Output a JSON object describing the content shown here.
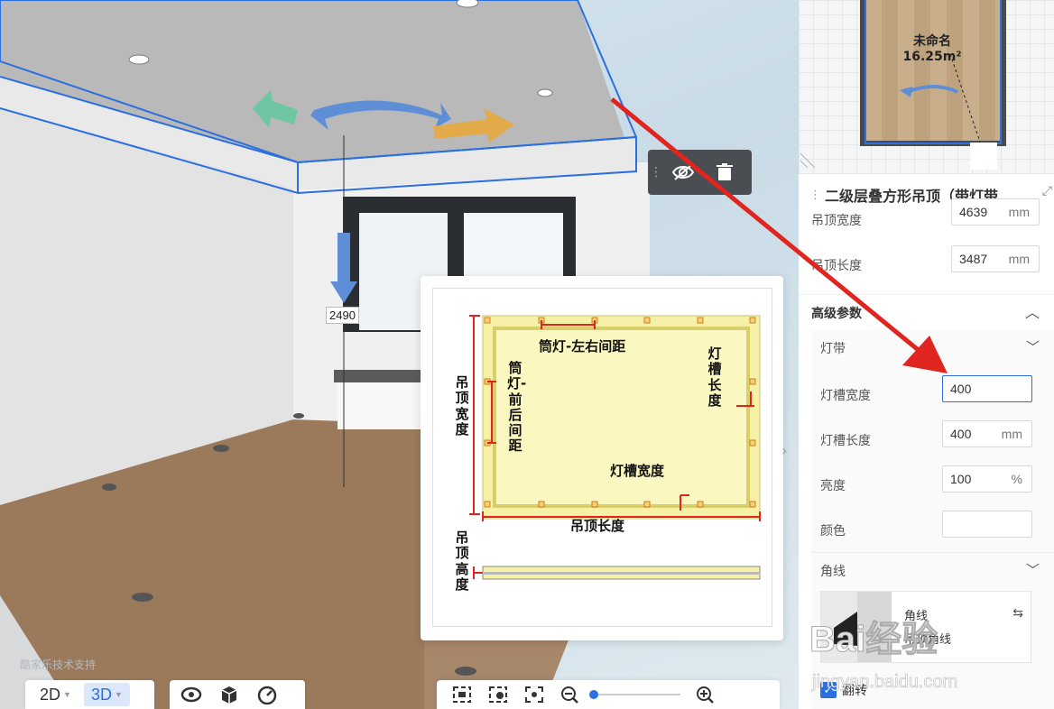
{
  "viewport": {
    "height_label": "2490",
    "watermark": "酷家乐技术支持",
    "view_modes": [
      {
        "label": "2D",
        "active": false
      },
      {
        "label": "3D",
        "active": true
      }
    ],
    "zoom_fraction": 0.0
  },
  "diagram": {
    "label_spot_lr": "筒灯-左右间距",
    "label_spot_fb": "筒灯-前后间距",
    "label_slot_length": "灯槽长度",
    "label_slot_width": "灯槽宽度",
    "label_ceiling_width": "吊顶宽度",
    "label_ceiling_length": "吊顶长度",
    "label_ceiling_height": "吊顶高度"
  },
  "minimap": {
    "room_name": "未命名",
    "room_area": "16.25m²"
  },
  "panel": {
    "title": "二级层叠方形吊顶（带灯带…",
    "ceiling_width": {
      "label": "吊顶宽度",
      "value": "4639",
      "unit": "mm"
    },
    "ceiling_length": {
      "label": "吊顶长度",
      "value": "3487",
      "unit": "mm"
    },
    "advanced_label": "高级参数",
    "light_strip": {
      "label": "灯带",
      "slot_width": {
        "label": "灯槽宽度",
        "value": "400"
      },
      "slot_length": {
        "label": "灯槽长度",
        "value": "400",
        "unit": "mm"
      },
      "brightness": {
        "label": "亮度",
        "value": "100",
        "unit": "%"
      },
      "color": {
        "label": "颜色",
        "value": ""
      }
    },
    "molding": {
      "label": "角线",
      "item_name_1": "角线",
      "item_name_2": "吊顶角线"
    },
    "flip": {
      "label": "翻转",
      "checked": true
    }
  },
  "watermark": {
    "brand": "Bai经验",
    "url": "jingyan.baidu.com"
  },
  "colors": {
    "accent": "#2b6fe0",
    "annotation_red": "#e0241f",
    "selection_blue": "#2b6fe0"
  }
}
